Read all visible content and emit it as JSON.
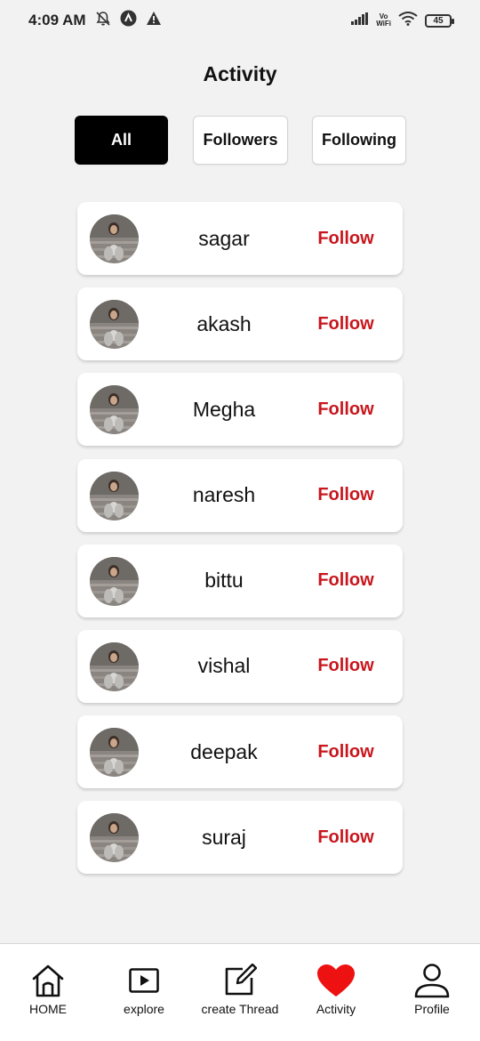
{
  "status_bar": {
    "time": "4:09 AM",
    "vowifi_top": "Vo",
    "vowifi_bottom": "WiFi",
    "battery": "45",
    "icons": [
      "notifications-off-icon",
      "app-badge-icon",
      "warning-icon",
      "signal-icon",
      "wifi-icon",
      "battery-icon"
    ]
  },
  "header": {
    "title": "Activity"
  },
  "tabs": [
    {
      "label": "All",
      "active": true
    },
    {
      "label": "Followers",
      "active": false
    },
    {
      "label": "Following",
      "active": false
    }
  ],
  "activity": {
    "items": [
      {
        "name": "sagar",
        "action": "Follow"
      },
      {
        "name": "akash",
        "action": "Follow"
      },
      {
        "name": "Megha",
        "action": "Follow"
      },
      {
        "name": "naresh",
        "action": "Follow"
      },
      {
        "name": "bittu",
        "action": "Follow"
      },
      {
        "name": "vishal",
        "action": "Follow"
      },
      {
        "name": "deepak",
        "action": "Follow"
      },
      {
        "name": "suraj",
        "action": "Follow"
      }
    ]
  },
  "nav": {
    "home": {
      "label": "HOME",
      "icon": "home-icon"
    },
    "explore": {
      "label": "explore",
      "icon": "play-icon"
    },
    "create": {
      "label": "create Thread",
      "icon": "edit-icon"
    },
    "activity": {
      "label": "Activity",
      "icon": "heart-icon",
      "active": true
    },
    "profile": {
      "label": "Profile",
      "icon": "user-icon"
    }
  },
  "colors": {
    "accent": "#c8161d",
    "heart": "#ee1111",
    "background": "#f2f2f2",
    "tab_active": "#000000"
  }
}
